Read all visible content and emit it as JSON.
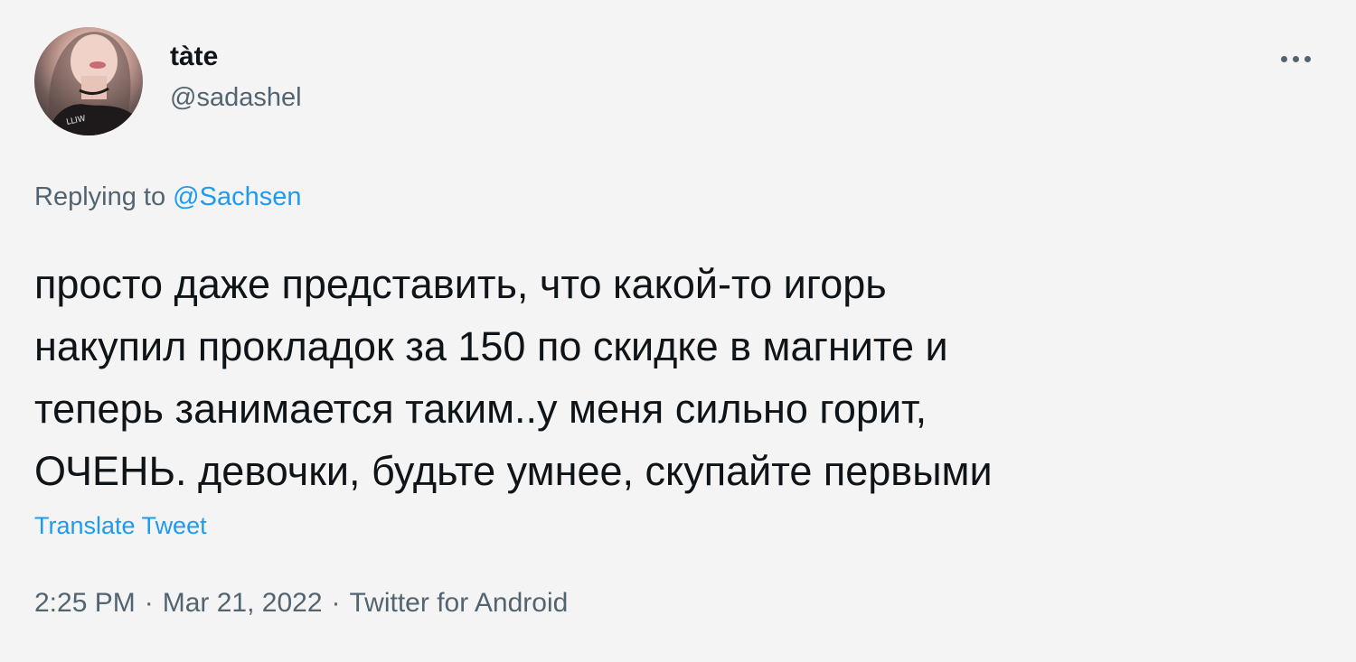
{
  "user": {
    "display_name": "tàte",
    "handle": "@sadashel"
  },
  "more_icon": "more-horizontal-icon",
  "reply": {
    "prefix": "Replying to ",
    "mention": "@Sachsen"
  },
  "tweet": {
    "lines": [
      "просто даже представить, что какой-то игорь",
      "накупил прокладок за 150 по скидке в магните и",
      "теперь занимается таким..у меня сильно горит,",
      "ОЧЕНЬ. девочки, будьте умнее, скупайте первыми"
    ]
  },
  "translate_label": "Translate Tweet",
  "meta": {
    "time": "2:25 PM",
    "separator": "·",
    "date": "Mar 21, 2022",
    "source": "Twitter for Android"
  },
  "colors": {
    "text_primary": "#0f1419",
    "text_secondary": "#536471",
    "accent": "#1d9bf0",
    "background": "#f4f4f4"
  }
}
